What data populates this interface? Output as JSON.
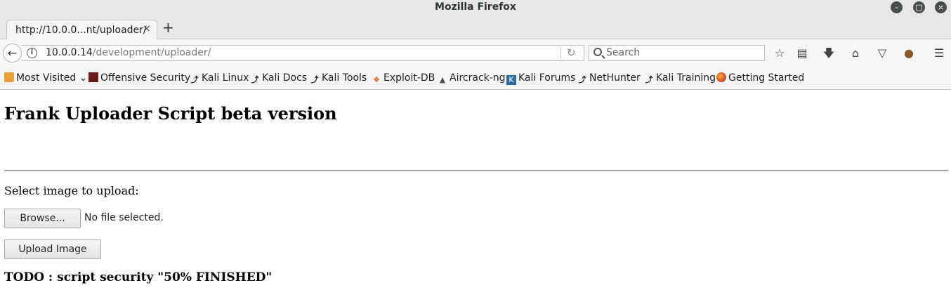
{
  "window": {
    "title": "Mozilla Firefox",
    "controls": [
      "minimize-icon",
      "maximize-icon",
      "close-icon"
    ]
  },
  "tabs": [
    {
      "label": "http://10.0.0...nt/uploader/",
      "close": "×"
    }
  ],
  "new_tab": "+",
  "navbar": {
    "url_host": "10.0.0.14",
    "url_path": "/development/uploader/",
    "search_placeholder": "Search",
    "icons": [
      "back-arrow-icon",
      "info-icon",
      "reload-icon",
      "search-icon",
      "bookmark-star-icon",
      "reading-list-icon",
      "download-icon",
      "home-icon",
      "pocket-icon",
      "cookie-icon",
      "menu-icon"
    ]
  },
  "bookmarks": [
    {
      "label": "Most Visited",
      "icon": "folder-icon"
    },
    {
      "label": "Offensive Security",
      "icon": "offsec-icon"
    },
    {
      "label": "Kali Linux",
      "icon": "kali-dragon-icon"
    },
    {
      "label": "Kali Docs",
      "icon": "kali-dragon-icon"
    },
    {
      "label": "Kali Tools",
      "icon": "kali-dragon-icon"
    },
    {
      "label": "Exploit-DB",
      "icon": "exploit-db-icon"
    },
    {
      "label": "Aircrack-ng",
      "icon": "aircrack-icon"
    },
    {
      "label": "Kali Forums",
      "icon": "forum-icon"
    },
    {
      "label": "NetHunter",
      "icon": "kali-dragon-icon"
    },
    {
      "label": "Kali Training",
      "icon": "kali-dragon-icon"
    },
    {
      "label": "Getting Started",
      "icon": "firefox-icon"
    }
  ],
  "page": {
    "title": "Frank Uploader Script beta version",
    "upload_label": "Select image to upload:",
    "browse_label": "Browse...",
    "file_status": "No file selected.",
    "upload_button": "Upload Image",
    "todo": "TODO : script security \"50% FINISHED\""
  },
  "colors": {
    "chrome_bg": "#e8e8e7",
    "toolbar_bg": "#f5f6f7",
    "page_bg": "#ffffff"
  }
}
